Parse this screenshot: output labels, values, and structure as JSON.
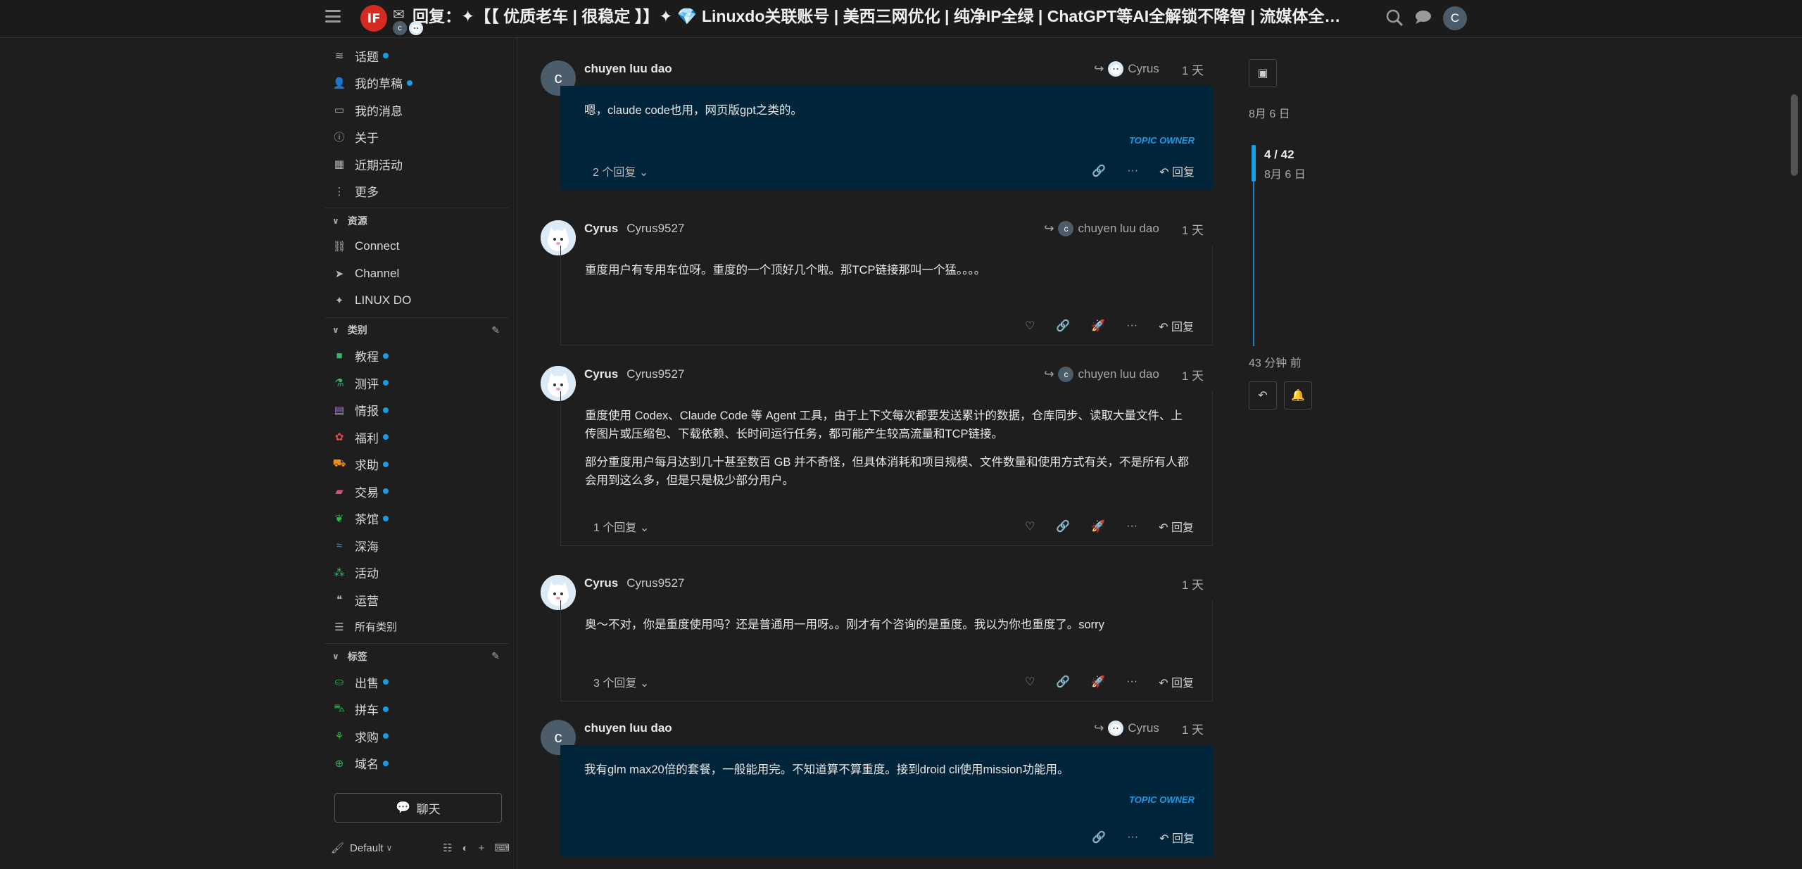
{
  "header": {
    "logo_text": "IF",
    "title": "回复：✦【【 优质老车 | 很稳定 】】✦ 💎 Linuxdo关联账号 | 美西三网优化 | 纯净IP全绿 | ChatGPT等AI全解锁不降智 | 流媒体全解锁...",
    "user_initial": "C"
  },
  "sidebar": {
    "top_items": [
      {
        "label": "话题",
        "icon": "layers-icon",
        "dot": true
      },
      {
        "label": "我的草稿",
        "icon": "user-icon",
        "dot": true
      },
      {
        "label": "我的消息",
        "icon": "inbox-icon",
        "dot": false
      },
      {
        "label": "关于",
        "icon": "info-icon",
        "dot": false
      },
      {
        "label": "近期活动",
        "icon": "calendar-icon",
        "dot": false
      },
      {
        "label": "更多",
        "icon": "more-vertical-icon",
        "dot": false
      }
    ],
    "resources_title": "资源",
    "resources": [
      {
        "label": "Connect",
        "icon": "link-icon"
      },
      {
        "label": "Channel",
        "icon": "telegram-icon"
      },
      {
        "label": "LINUX DO",
        "icon": "sparkle-icon"
      }
    ],
    "categories_title": "类别",
    "categories": [
      {
        "label": "教程",
        "color": "#3ab26d",
        "dot": true
      },
      {
        "label": "测评",
        "color": "#3ab26d",
        "dot": true
      },
      {
        "label": "情报",
        "color": "#b279e0",
        "dot": true
      },
      {
        "label": "福利",
        "color": "#e24b4b",
        "dot": true
      },
      {
        "label": "求助",
        "color": "#f08c1e",
        "dot": true
      },
      {
        "label": "交易",
        "color": "#e24b7d",
        "dot": true
      },
      {
        "label": "茶馆",
        "color": "#2fb84a",
        "dot": true
      },
      {
        "label": "深海",
        "color": "#3a8fd8",
        "dot": false
      },
      {
        "label": "活动",
        "color": "#3ab26d",
        "dot": false
      },
      {
        "label": "运营",
        "color": "#aaaaaa",
        "dot": false
      }
    ],
    "all_categories": "所有类别",
    "tags_title": "标签",
    "tags": [
      {
        "label": "出售",
        "color": "#2fb84a",
        "dot": true
      },
      {
        "label": "拼车",
        "color": "#2fb84a",
        "dot": true
      },
      {
        "label": "求购",
        "color": "#2fb84a",
        "dot": true
      },
      {
        "label": "域名",
        "color": "#2fb84a",
        "dot": true
      }
    ],
    "chat_label": "聊天",
    "footer_theme": "Default"
  },
  "posts": [
    {
      "name": "chuyen luu dao",
      "username": "",
      "reply_to": "Cyrus",
      "date": "1 天",
      "paragraphs": [
        "嗯，claude code也用，网页版gpt之类的。"
      ],
      "owner_tag": "TOPIC OWNER",
      "replies": "2 个回复",
      "reply_label": "回复"
    },
    {
      "name": "Cyrus",
      "username": "Cyrus9527",
      "reply_to": "chuyen luu dao",
      "date": "1 天",
      "paragraphs": [
        "重度用户有专用车位呀。重度的一个顶好几个啦。那TCP链接那叫一个猛。。。。"
      ],
      "replies": "",
      "reply_label": "回复"
    },
    {
      "name": "Cyrus",
      "username": "Cyrus9527",
      "reply_to": "chuyen luu dao",
      "date": "1 天",
      "paragraphs": [
        "重度使用 Codex、Claude Code 等 Agent 工具，由于上下文每次都要发送累计的数据，仓库同步、读取大量文件、上传图片或压缩包、下载依赖、长时间运行任务，都可能产生较高流量和TCP链接。",
        "部分重度用户每月达到几十甚至数百 GB 并不奇怪，但具体消耗和项目规模、文件数量和使用方式有关，不是所有人都会用到这么多，但是只是极少部分用户。"
      ],
      "replies": "1 个回复",
      "reply_label": "回复"
    },
    {
      "name": "Cyrus",
      "username": "Cyrus9527",
      "reply_to": "",
      "date": "1 天",
      "paragraphs": [
        "奥～不对，你是重度使用吗？还是普通用一用呀。。刚才有个咨询的是重度。我以为你也重度了。sorry"
      ],
      "replies": "3 个回复",
      "reply_label": "回复"
    },
    {
      "name": "chuyen luu dao",
      "username": "",
      "reply_to": "Cyrus",
      "date": "1 天",
      "paragraphs": [
        "我有glm max20倍的套餐，一般能用完。不知道算不算重度。接到droid cli使用mission功能用。"
      ],
      "owner_tag": "TOPIC OWNER",
      "replies": "",
      "reply_label": "回复"
    }
  ],
  "timeline": {
    "start_date": "8月 6 日",
    "position": "4 / 42",
    "position_date": "8月 6 日",
    "last_activity": "43 分钟 前"
  }
}
